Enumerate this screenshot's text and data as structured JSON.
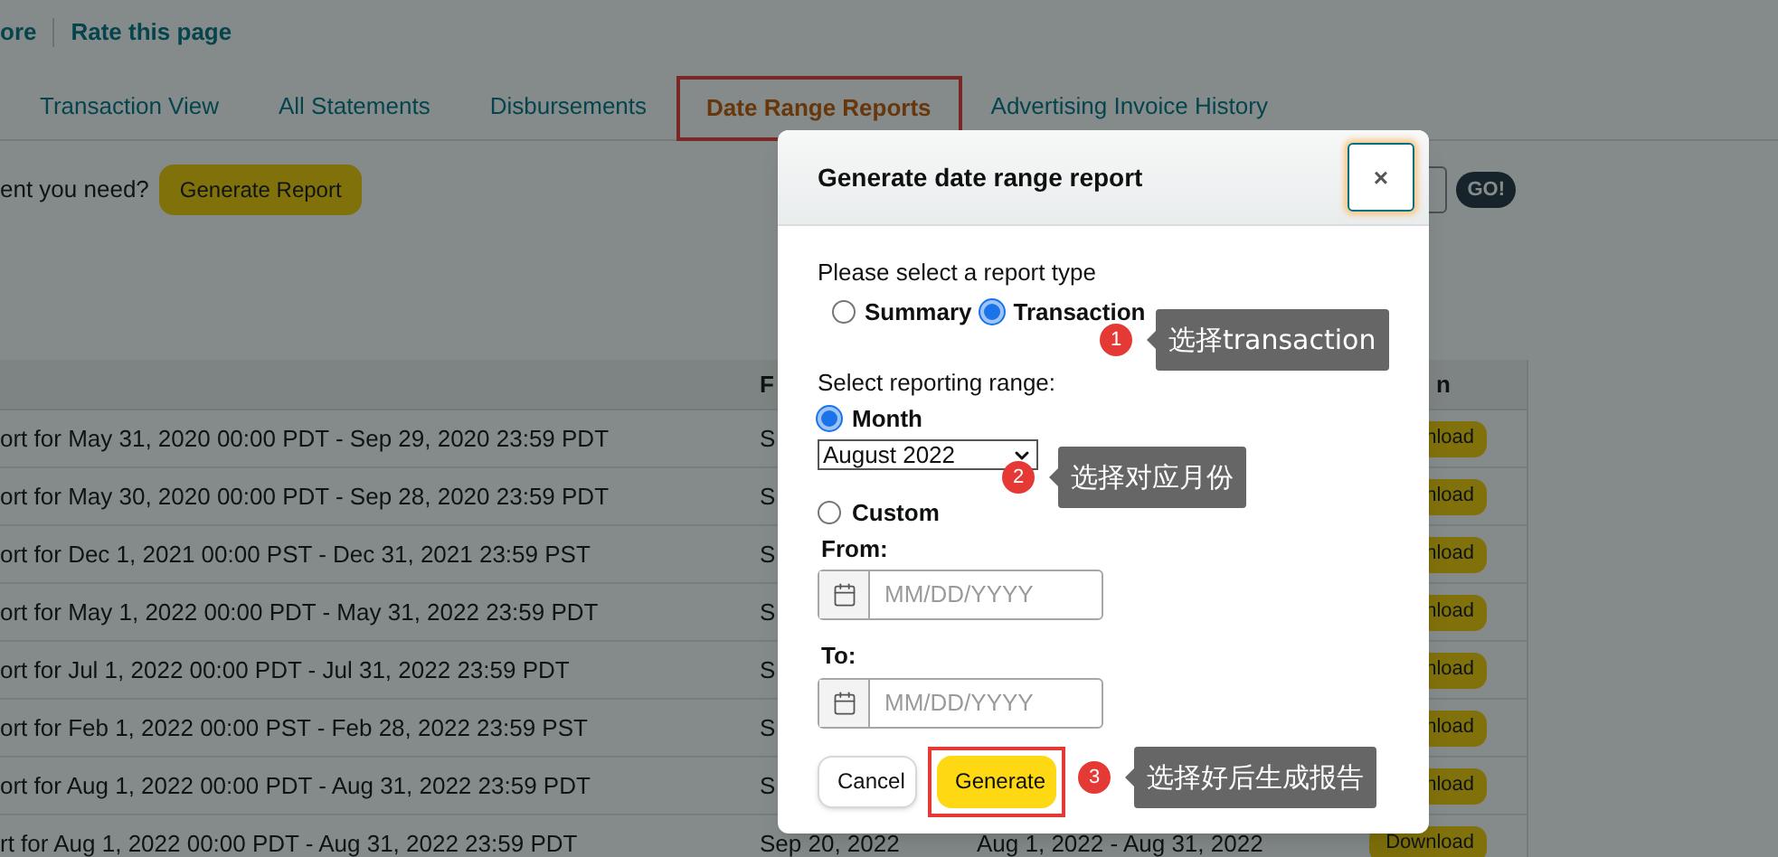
{
  "header_links": [
    {
      "label": "ore"
    },
    {
      "label": "Rate this page"
    }
  ],
  "tabs": [
    {
      "label": "Transaction View",
      "selected": false,
      "highlighted": false
    },
    {
      "label": "All Statements",
      "selected": false,
      "highlighted": false
    },
    {
      "label": "Disbursements",
      "selected": false,
      "highlighted": false
    },
    {
      "label": "Date Range Reports",
      "selected": true,
      "highlighted": true
    },
    {
      "label": "Advertising Invoice History",
      "selected": false,
      "highlighted": false
    }
  ],
  "prompt": "ent you need?",
  "generate_report_button": "Generate Report",
  "go_button": "GO!",
  "table": {
    "column_headers": {
      "column_2": "F",
      "column_4": "n"
    },
    "rows": [
      {
        "cells": [
          "ort for May 31, 2020 00:00 PDT - Sep 29, 2020 23:59 PDT",
          "S"
        ],
        "action": "nload"
      },
      {
        "cells": [
          "ort for May 30, 2020 00:00 PDT - Sep 28, 2020 23:59 PDT",
          "S"
        ],
        "action": "nload"
      },
      {
        "cells": [
          "ort for Dec 1, 2021 00:00 PST - Dec 31, 2021 23:59 PST",
          "S"
        ],
        "action": "nload"
      },
      {
        "cells": [
          "ort for May 1, 2022 00:00 PDT - May 31, 2022 23:59 PDT",
          "S"
        ],
        "action": "nload"
      },
      {
        "cells": [
          "ort for Jul 1, 2022 00:00 PDT - Jul 31, 2022 23:59 PDT",
          "S"
        ],
        "action": "nload"
      },
      {
        "cells": [
          "ort for Feb 1, 2022 00:00 PST - Feb 28, 2022 23:59 PST",
          "S"
        ],
        "action": "nload"
      },
      {
        "cells": [
          "ort for Aug 1, 2022 00:00 PDT - Aug 31, 2022 23:59 PDT",
          "S"
        ],
        "action": "nload"
      },
      {
        "cells": [
          "rt for Aug 1, 2022 00:00 PDT - Aug 31, 2022 23:59 PDT",
          "Sep 20, 2022",
          "Aug 1, 2022 - Aug 31, 2022"
        ],
        "action": "Download"
      }
    ]
  },
  "dialog": {
    "title": "Generate date range report",
    "close": "×",
    "report_type_label": "Please select a report type",
    "report_types": [
      {
        "label": "Summary",
        "selected": false
      },
      {
        "label": "Transaction",
        "selected": true
      }
    ],
    "range_label": "Select reporting range:",
    "month": {
      "label": "Month",
      "selected": true,
      "value": "August 2022"
    },
    "custom": {
      "label": "Custom",
      "selected": false,
      "from_label": "From:",
      "from_placeholder": "MM/DD/YYYY",
      "to_label": "To:",
      "to_placeholder": "MM/DD/YYYY"
    },
    "buttons": [
      {
        "label": "Cancel",
        "kind": "secondary",
        "highlighted": false
      },
      {
        "label": "Generate",
        "kind": "primary",
        "highlighted": true
      }
    ]
  },
  "annotations": [
    {
      "number": "1",
      "text": "选择transaction"
    },
    {
      "number": "2",
      "text": "选择对应月份"
    },
    {
      "number": "3",
      "text": "选择好后生成报告"
    }
  ]
}
